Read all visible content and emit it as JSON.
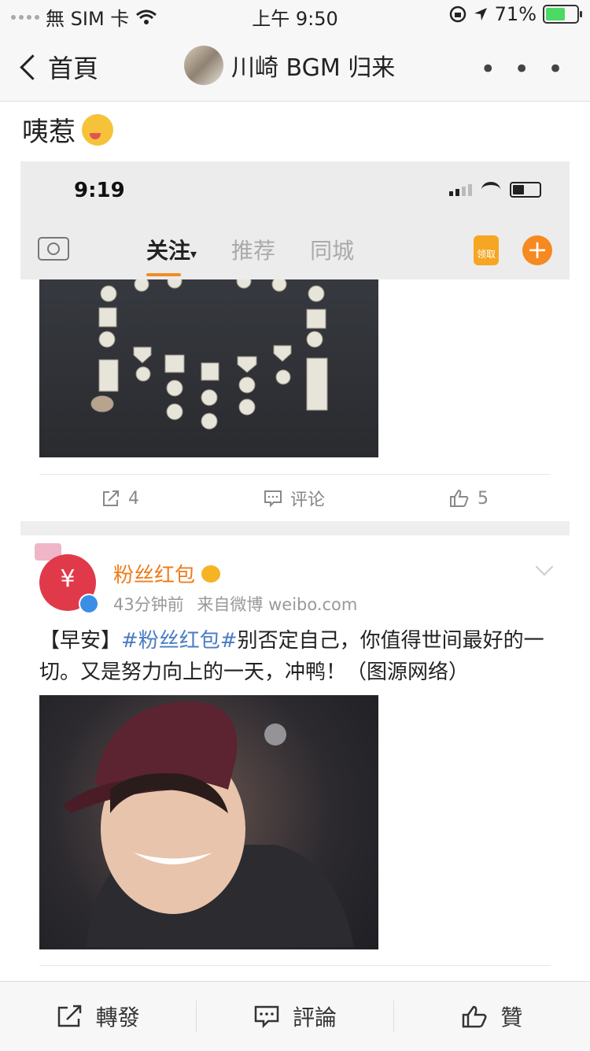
{
  "status_bar": {
    "carrier": "無 SIM 卡",
    "time": "上午 9:50",
    "battery_percent": "71%",
    "battery_level": 0.71
  },
  "nav": {
    "back_label": "首頁",
    "title": "川崎 BGM 归来",
    "more_label": "• • •"
  },
  "post": {
    "text": "咦惹"
  },
  "embedded_screenshot": {
    "time": "9:19",
    "tabs": [
      "关注",
      "推荐",
      "同城"
    ],
    "active_tab_suffix": "▾",
    "gift_label": "领取",
    "plus_label": "+"
  },
  "feed_actions": {
    "repost_count": "4",
    "comment_label": "评论",
    "like_count": "5"
  },
  "card2": {
    "name": "粉丝红包",
    "time": "43分钟前",
    "source": "来自微博 weibo.com",
    "text_prefix": "【早安】",
    "hashtag": "#粉丝红包#",
    "text_body": "别否定自己，你值得世间最好的一切。又是努力向上的一天，冲鸭！（图源网络）"
  },
  "toolbar": {
    "repost_label": "轉發",
    "comment_label": "評論",
    "like_label": "贊"
  },
  "colors": {
    "accent_orange": "#f07c1c",
    "hashtag_blue": "#4a7cc2",
    "background": "#f7f7f7"
  }
}
